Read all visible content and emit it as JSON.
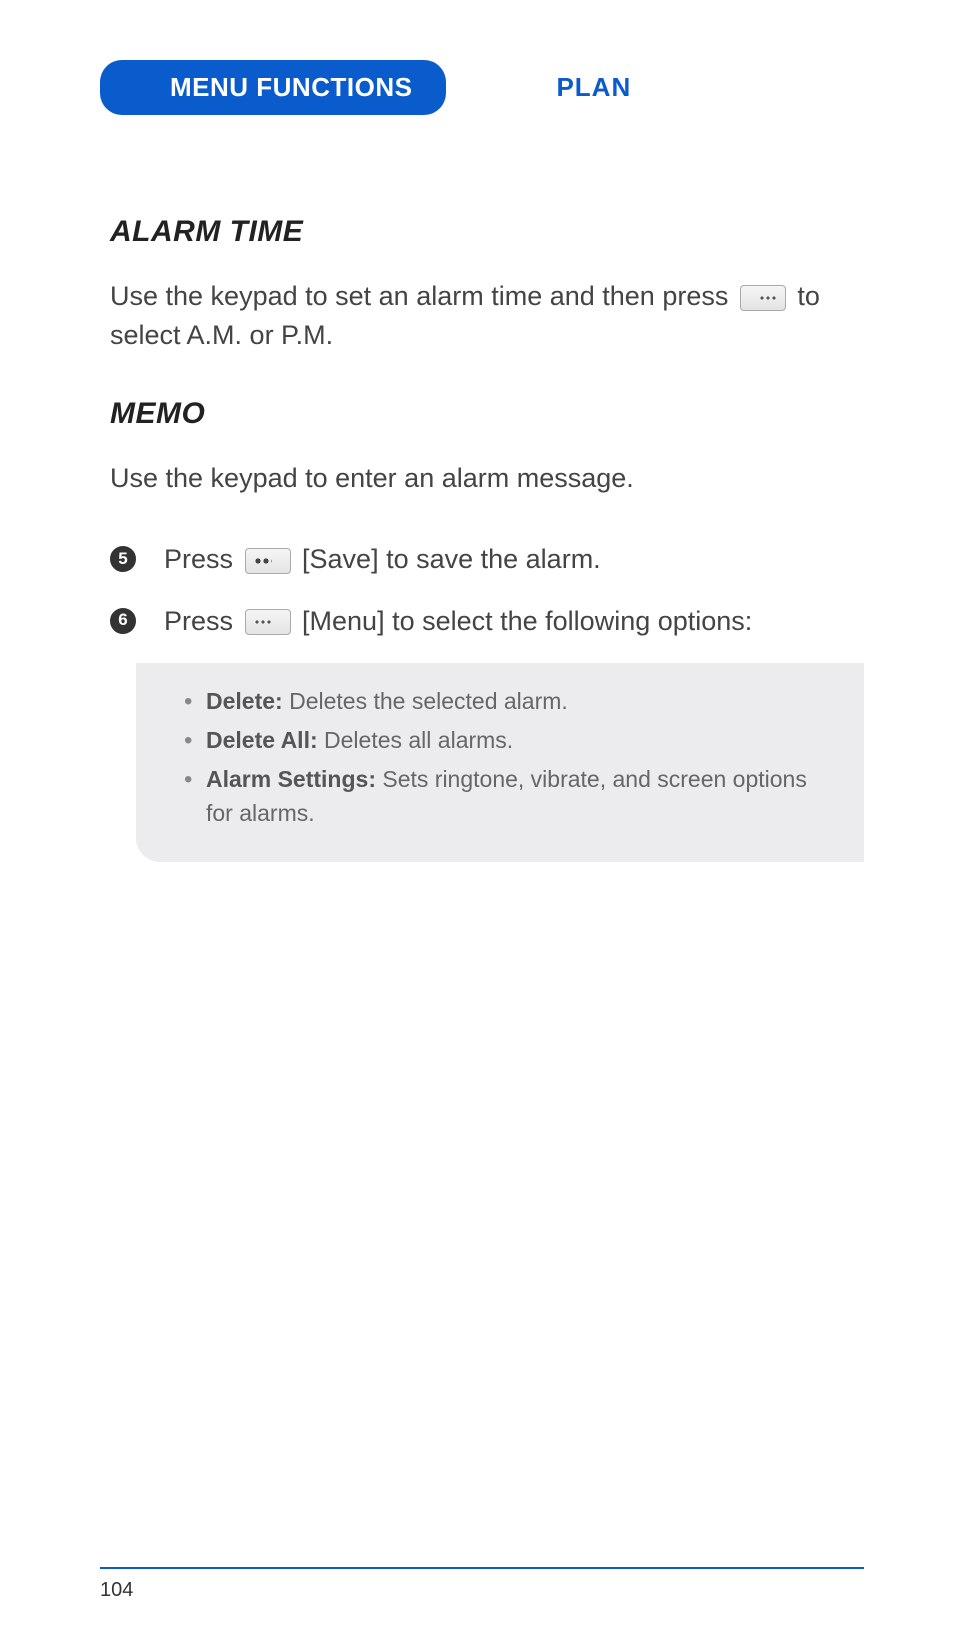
{
  "header": {
    "tab": "MENU FUNCTIONS",
    "section": "PLAN"
  },
  "sections": {
    "alarm_time": {
      "title": "ALARM TIME",
      "text_before_icon": "Use the keypad to set an alarm time and then press ",
      "text_after_icon": " to select A.M. or P.M."
    },
    "memo": {
      "title": "MEMO",
      "intro": "Use the keypad to enter an alarm message.",
      "steps": [
        {
          "num": "5",
          "before": "Press ",
          "after": " [Save] to save the alarm."
        },
        {
          "num": "6",
          "before": "Press ",
          "after": " [Menu] to select the following options:"
        }
      ],
      "options": [
        {
          "label": "Delete:",
          "desc": " Deletes the selected alarm."
        },
        {
          "label": "Delete All:",
          "desc": " Deletes all alarms."
        },
        {
          "label": "Alarm Settings:",
          "desc": " Sets ringtone, vibrate, and screen options for alarms."
        }
      ]
    }
  },
  "page_number": "104"
}
